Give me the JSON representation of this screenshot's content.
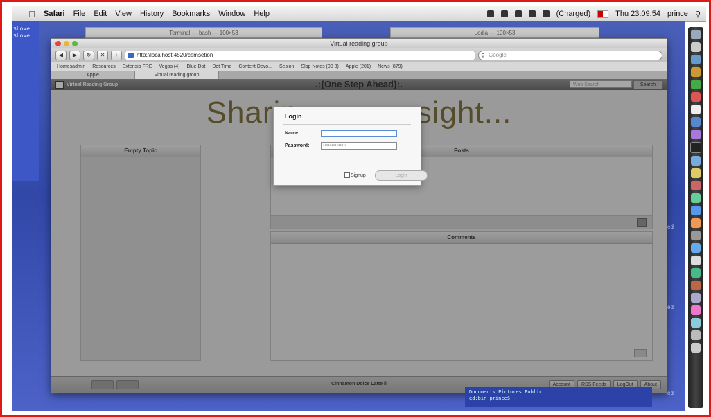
{
  "menubar": {
    "app": "Safari",
    "menus": [
      "File",
      "Edit",
      "View",
      "History",
      "Bookmarks",
      "Window",
      "Help"
    ],
    "battery": "(Charged)",
    "clock": "Thu 23:09:54",
    "user": "prince"
  },
  "desktop": {
    "terminal_left_labels": [
      "$Love",
      "$Love"
    ],
    "bg_terminal_title_1": "Terminal — bash — 100×53",
    "bg_terminal_title_2": "Lodia — 100×53",
    "right_labels": [
      "ed",
      "ed",
      "ed"
    ]
  },
  "safari": {
    "window_title": "Virtual reading group",
    "url": "http://localhost:4520/cemsetion",
    "search_placeholder": "Google",
    "bookmarks": [
      "Homesadmin",
      "Resources",
      "Extensio FRE",
      "Vegas (4)",
      "Blue Dot",
      "Dot Time",
      "Content Devo...",
      "Sesion",
      "Slap Notes (08 3)",
      "Apple (201)",
      "News (879)"
    ],
    "tabs": [
      "Apple",
      "Virtual reading group"
    ]
  },
  "app": {
    "brand": "Virtual Reading Group",
    "header_title": ".:{One Step Ahead}:.",
    "search_placeholder": "Web Search",
    "search_button": "Search",
    "hero_left": "Sharin",
    "hero_right": "sight...",
    "left_panel_title": "Empty Topic",
    "posts_title": "Posts",
    "comments_title": "Comments",
    "footer_text": "Cinnamon Dolce Latte ii",
    "footer_buttons": [
      "Account",
      "RSS Feeds",
      "LogOut",
      "About"
    ]
  },
  "login": {
    "title": "Login",
    "name_label": "Name:",
    "name_value": "",
    "password_label": "Password:",
    "password_value": "••••••••••••••",
    "signup_label": "Signup",
    "login_button": "Login"
  },
  "terminal_snippet": [
    "Documents Pictures Public",
    "ed:bin prince$ ~"
  ],
  "colors": {
    "frame_border": "#e01818",
    "desktop_blue": "#3148a8",
    "hero_text": "#6a5a1a",
    "focus_ring": "#5a8fd8"
  }
}
